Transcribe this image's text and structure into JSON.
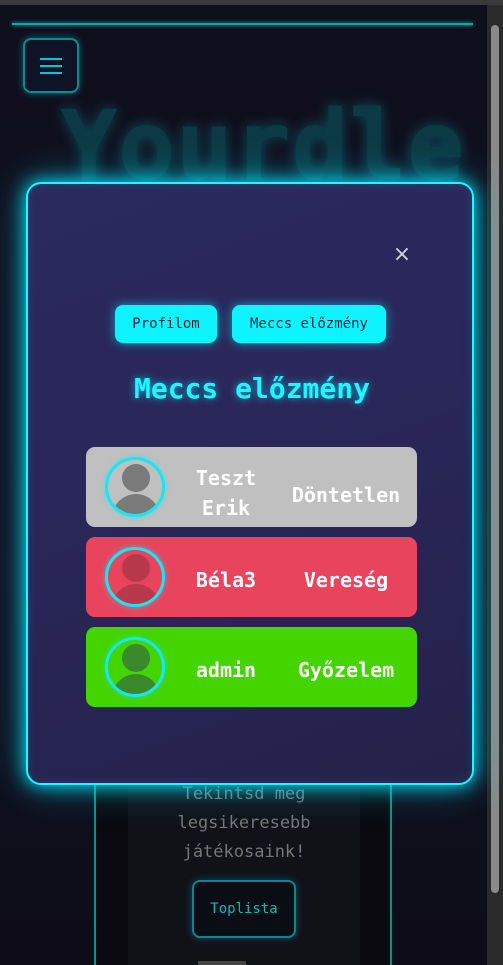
{
  "background": {
    "title": "Yourdle",
    "menu_icon": "hamburger-icon",
    "card_text": [
      "Tekintsd meg",
      "legsikeresebb",
      "játékosaink!"
    ],
    "card_button": "Toplista"
  },
  "modal": {
    "close_icon": "close-icon",
    "close_label": "×",
    "tabs": [
      {
        "label": "Profilom"
      },
      {
        "label": "Meccs előzmény"
      }
    ],
    "title": "Meccs előzmény",
    "matches": [
      {
        "player": "Teszt Erik",
        "result": "Döntetlen",
        "color": "#c0c0c0",
        "avatar_color": "#7a7a7a"
      },
      {
        "player": "Béla3",
        "result": "Vereség",
        "color": "#e8445e",
        "avatar_color": "#b8384c"
      },
      {
        "player": "admin",
        "result": "Győzelem",
        "color": "#44d400",
        "avatar_color": "#3a8a2c"
      }
    ]
  },
  "colors": {
    "accent": "#1ff6ff",
    "draw": "#c0c0c0",
    "loss": "#e8445e",
    "win": "#44d400"
  }
}
